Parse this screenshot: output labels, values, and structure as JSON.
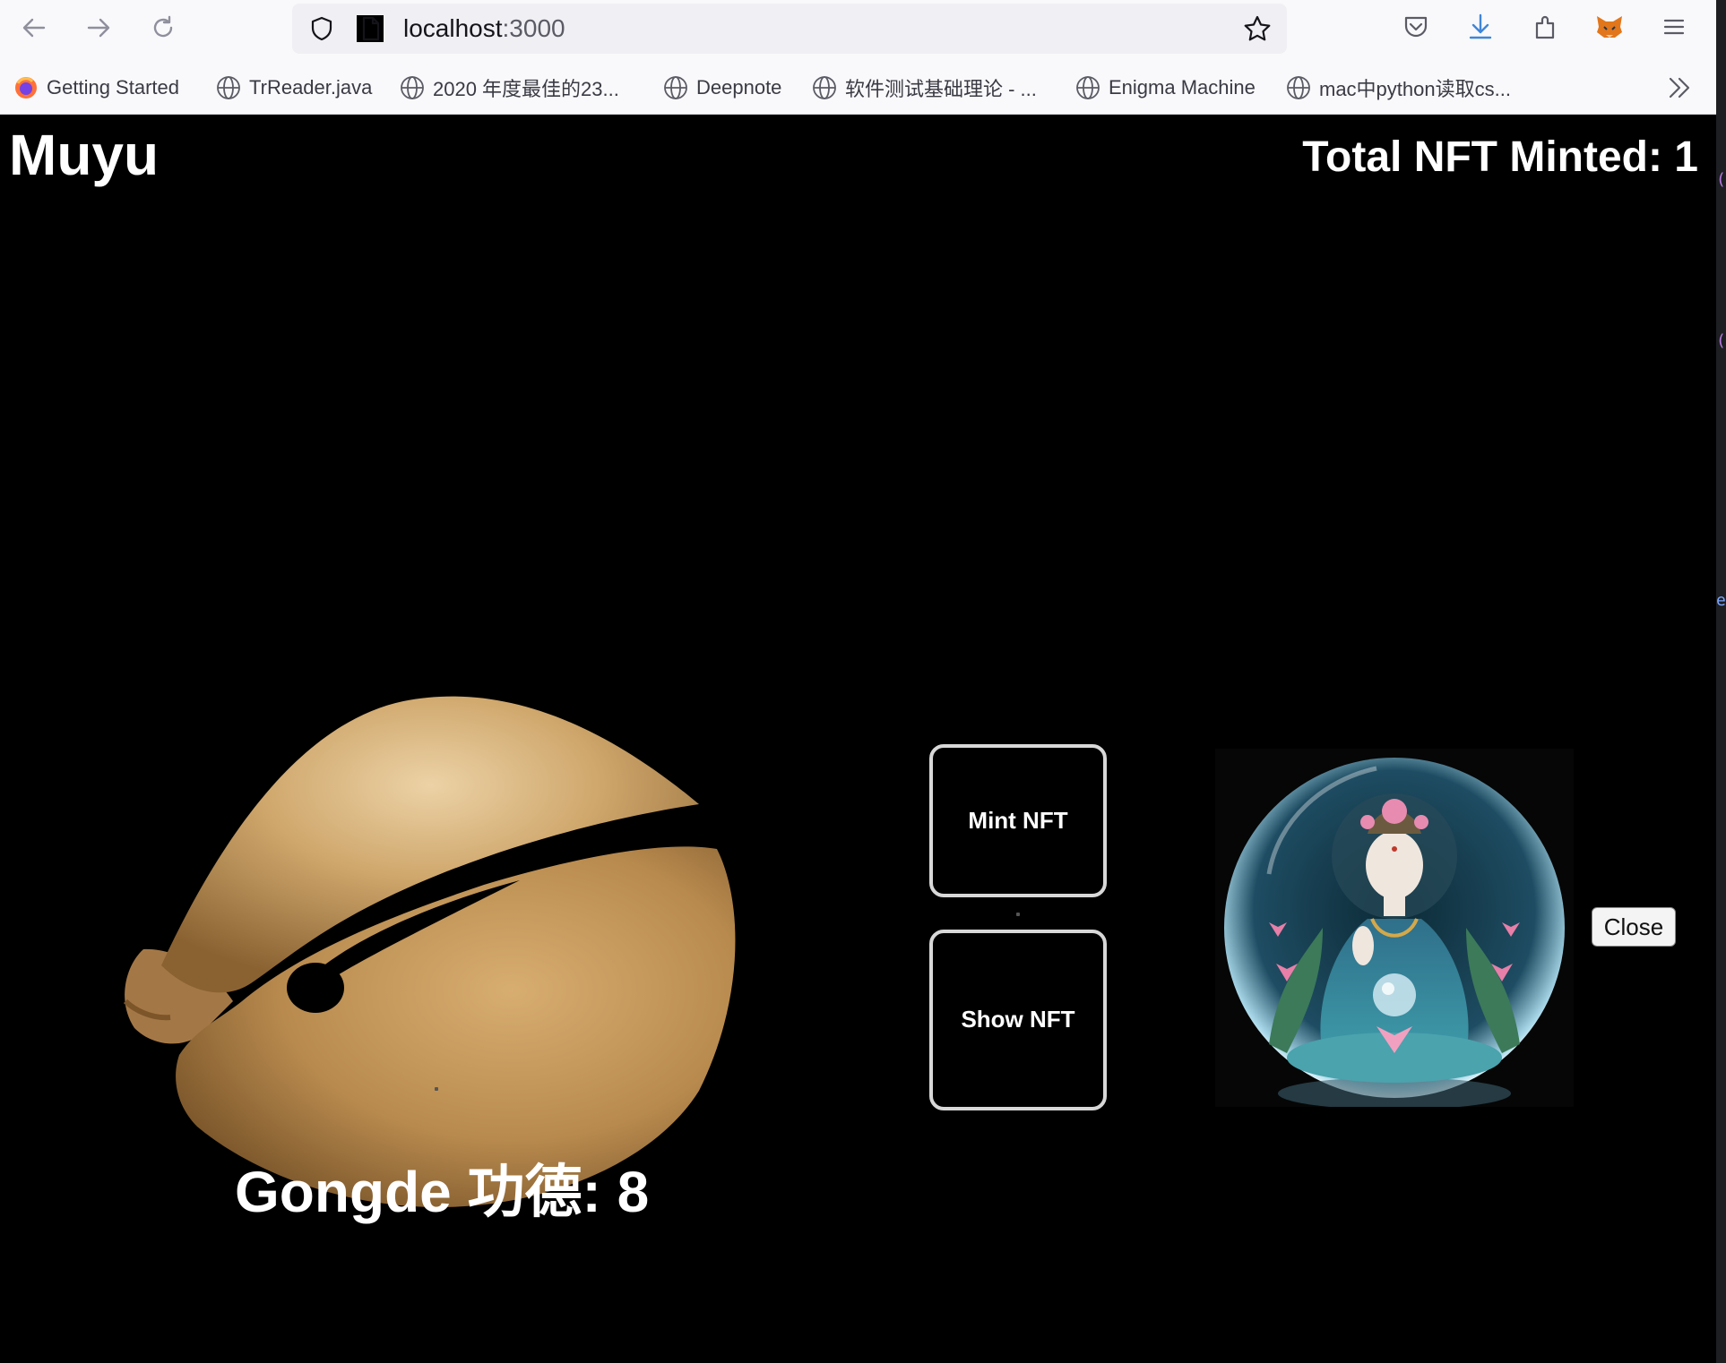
{
  "browser": {
    "url_host": "localhost",
    "url_port": ":3000",
    "bookmarks": [
      {
        "label": "Getting Started",
        "icon": "firefox-icon"
      },
      {
        "label": "TrReader.java",
        "icon": "globe-icon"
      },
      {
        "label": "2020 年度最佳的23...",
        "icon": "globe-icon"
      },
      {
        "label": "Deepnote",
        "icon": "globe-icon"
      },
      {
        "label": "软件测试基础理论 - ...",
        "icon": "globe-icon"
      },
      {
        "label": "Enigma Machine",
        "icon": "globe-icon"
      },
      {
        "label": "mac中python读取cs...",
        "icon": "globe-icon"
      }
    ]
  },
  "header": {
    "brand": "Muyu",
    "total_minted": "Total NFT Minted: 1"
  },
  "main": {
    "score": "Gongde 功德: 8",
    "mint_label": "Mint NFT",
    "show_label": "Show NFT",
    "close_label": "Close"
  },
  "colors": {
    "page_bg": "#000000",
    "muyu_wood": "#c89a60",
    "button_border": "#d8d8d8",
    "accent_blue": "#3f86d8"
  }
}
